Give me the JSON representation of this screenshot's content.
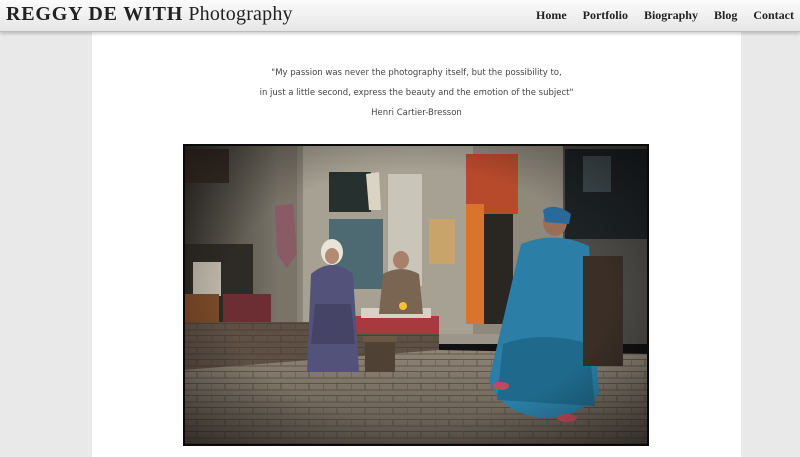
{
  "header": {
    "site_name": "REGGY DE WITH",
    "site_suffix": "Photography",
    "nav": [
      {
        "label": "Home"
      },
      {
        "label": "Portfolio"
      },
      {
        "label": "Biography"
      },
      {
        "label": "Blog"
      },
      {
        "label": "Contact"
      }
    ]
  },
  "main": {
    "quote_line1": "\"My passion was never the photography itself, but the possibility to,",
    "quote_line2": "in just a little second, express the beauty and the emotion of the subject\"",
    "quote_author": "Henri Cartier-Bresson"
  },
  "colors": {
    "page_background": "#e9e9e9",
    "content_background": "#ffffff",
    "header_gradient_top": "#fbfbfb",
    "header_gradient_bottom": "#e6e6e6"
  }
}
